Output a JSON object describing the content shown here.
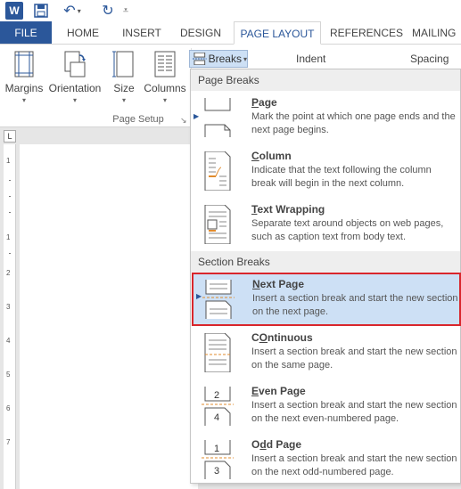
{
  "qat": {
    "app_letter": "W",
    "save_icon": "save-icon",
    "undo_icon": "undo-icon",
    "redo_icon": "redo-icon"
  },
  "tabs": [
    {
      "label": "FILE"
    },
    {
      "label": "HOME"
    },
    {
      "label": "INSERT"
    },
    {
      "label": "DESIGN"
    },
    {
      "label": "PAGE LAYOUT"
    },
    {
      "label": "REFERENCES"
    },
    {
      "label": "MAILING"
    }
  ],
  "ribbon": {
    "margins": "Margins",
    "orientation": "Orientation",
    "size": "Size",
    "columns": "Columns",
    "group_label": "Page Setup",
    "breaks": "Breaks",
    "indent": "Indent",
    "spacing": "Spacing"
  },
  "ruler": {
    "tab_selector": "L",
    "numbers": [
      "1",
      "1",
      "2",
      "3",
      "4",
      "5",
      "6",
      "7"
    ]
  },
  "menu": {
    "page_breaks_header": "Page Breaks",
    "section_breaks_header": "Section Breaks",
    "page_breaks": [
      {
        "title_u": "P",
        "title_rest": "age",
        "desc": "Mark the point at which one page ends and the next page begins."
      },
      {
        "title_u": "C",
        "title_rest": "olumn",
        "desc": "Indicate that the text following the column break will begin in the next column."
      },
      {
        "title_u": "T",
        "title_rest": "ext Wrapping",
        "desc": "Separate text around objects on web pages, such as caption text from body text."
      }
    ],
    "section_breaks": [
      {
        "title_u": "N",
        "title_rest": "ext Page",
        "desc": "Insert a section break and start the new section on the next page."
      },
      {
        "title_u": "O",
        "title_rest": "ntinuous",
        "title_pre": "C",
        "desc": "Insert a section break and start the new section on the same page."
      },
      {
        "title_u": "E",
        "title_rest": "ven Page",
        "desc": "Insert a section break and start the new section on the next even-numbered page."
      },
      {
        "title_u": "d",
        "title_rest": "d Page",
        "title_pre": "O",
        "desc": "Insert a section break and start the new section on the next odd-numbered page."
      }
    ],
    "icon_numbers": {
      "even_top": "2",
      "even_bottom": "4",
      "odd_top": "1",
      "odd_bottom": "3"
    }
  },
  "colors": {
    "accent": "#2b579a",
    "highlight": "#cde0f5",
    "selection_border": "#d9262c"
  }
}
